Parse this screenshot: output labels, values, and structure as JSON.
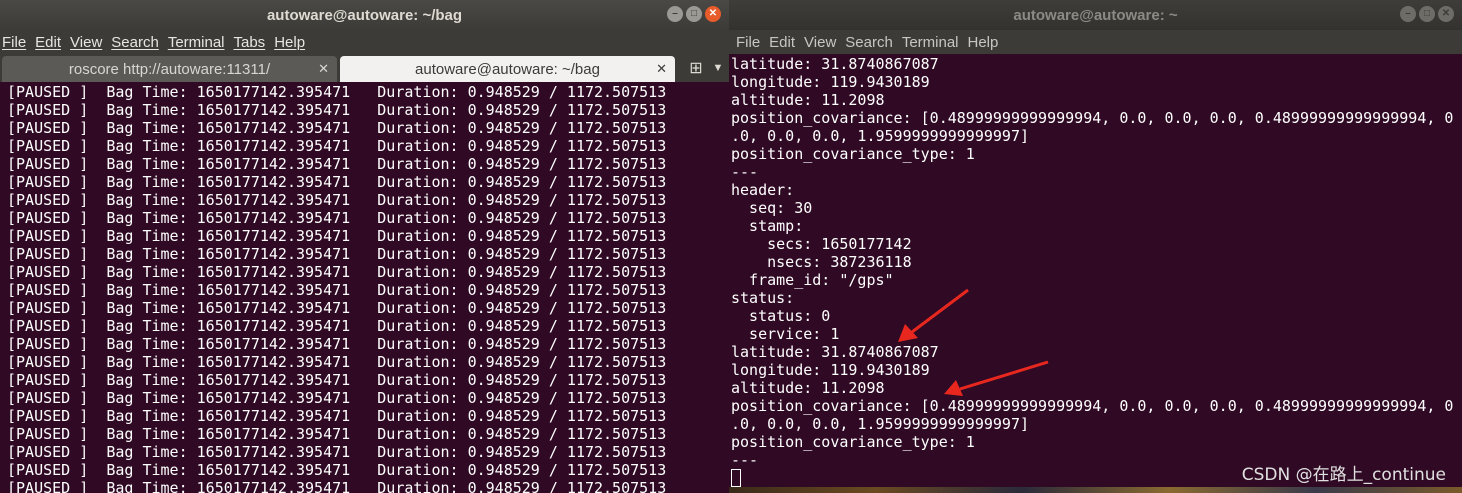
{
  "left_window": {
    "title": "autoware@autoware: ~/bag",
    "menu": [
      "File",
      "Edit",
      "View",
      "Search",
      "Terminal",
      "Tabs",
      "Help"
    ],
    "tabs": [
      {
        "label": "roscore http://autoware:11311/",
        "active": false
      },
      {
        "label": "autoware@autoware: ~/bag",
        "active": true
      }
    ],
    "log_line": "[PAUSED ]  Bag Time: 1650177142.395471   Duration: 0.948529 / 1172.507513",
    "log_line_count": 23
  },
  "right_window": {
    "title": "autoware@autoware: ~",
    "menu": [
      "File",
      "Edit",
      "View",
      "Search",
      "Terminal",
      "Help"
    ],
    "lines": [
      "latitude: 31.8740867087",
      "longitude: 119.9430189",
      "altitude: 11.2098",
      "position_covariance: [0.48999999999999994, 0.0, 0.0, 0.0, 0.48999999999999994, 0",
      ".0, 0.0, 0.0, 1.9599999999999997]",
      "position_covariance_type: 1",
      "---",
      "header:",
      "  seq: 30",
      "  stamp:",
      "    secs: 1650177142",
      "    nsecs: 387236118",
      "  frame_id: \"/gps\"",
      "status:",
      "  status: 0",
      "  service: 1",
      "latitude: 31.8740867087",
      "longitude: 119.9430189",
      "altitude: 11.2098",
      "position_covariance: [0.48999999999999994, 0.0, 0.0, 0.0, 0.48999999999999994, 0",
      ".0, 0.0, 0.0, 1.9599999999999997]",
      "position_covariance_type: 1",
      "---"
    ]
  },
  "watermark": "CSDN @在路上_continue",
  "colors": {
    "terminal_bg": "#300a24",
    "terminal_fg": "#ffffff",
    "titlebar_active": "#3c3b37",
    "close_button": "#e85b2a",
    "annotation_arrow": "#e8271f"
  },
  "icons": {
    "minimize": "minimize-icon",
    "maximize": "maximize-icon",
    "close": "close-icon",
    "new_tab": "new-tab-icon",
    "tab_menu": "chevron-down-icon"
  }
}
